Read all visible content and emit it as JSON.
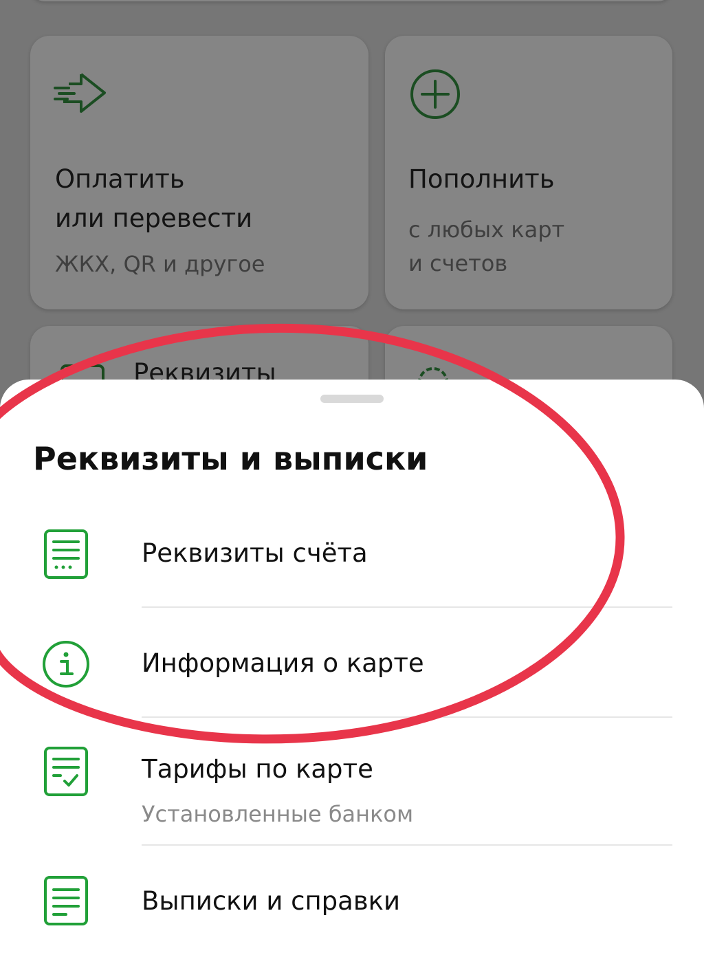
{
  "background": {
    "pay_card": {
      "title": "Оплатить\nили перевести",
      "subtitle": "ЖКХ, QR и другое",
      "icon": "transfer-arrow-icon"
    },
    "topup_card": {
      "title": "Пополнить",
      "subtitle": "с любых карт\nи счетов",
      "icon": "plus-circle-icon"
    },
    "requisites_card": {
      "title": "Реквизиты",
      "icon": "card-icon"
    },
    "settings_card": {
      "icon": "gear-icon"
    }
  },
  "sheet": {
    "title": "Реквизиты и выписки",
    "items": [
      {
        "label": "Реквизиты счёта",
        "icon": "document-list-icon"
      },
      {
        "label": "Информация о карте",
        "icon": "info-circle-icon"
      },
      {
        "label": "Тарифы по карте",
        "subtitle": "Установленные банком",
        "icon": "document-check-icon"
      },
      {
        "label": "Выписки и справки",
        "icon": "document-lines-icon"
      }
    ]
  },
  "colors": {
    "accent_green": "#21A038",
    "annotation_red": "#E8354A",
    "overlay_gray": "#767676"
  }
}
